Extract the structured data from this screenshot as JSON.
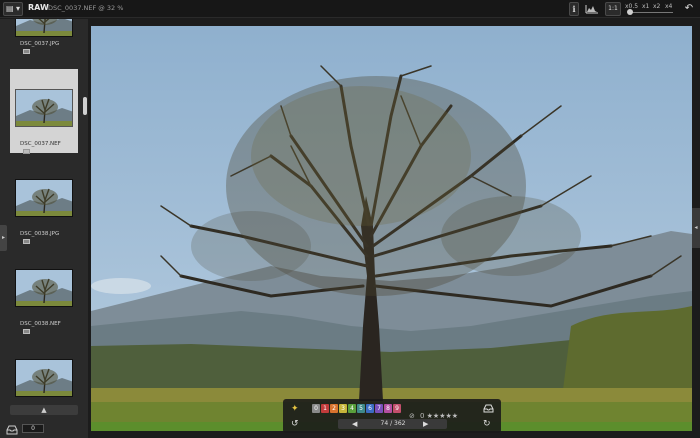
{
  "topbar": {
    "menu_glyph": "▤ ▾",
    "raw_label": "RAW",
    "file_title": "DSC_0037.NEF @ 32 %",
    "info_glyph": "i",
    "zoom_mode_label": "1:1",
    "zoom_labels": [
      "x0.5",
      "x1",
      "x2",
      "x4"
    ],
    "undo_glyph": "↶"
  },
  "sidebar": {
    "thumbnails": [
      {
        "name": "DSC_0037.JPG",
        "selected": false
      },
      {
        "name": "DSC_0037.NEF",
        "selected": true
      },
      {
        "name": "DSC_0038.JPG",
        "selected": false
      },
      {
        "name": "DSC_0038.NEF",
        "selected": false
      },
      {
        "name": "",
        "selected": false
      }
    ],
    "up_glyph": "▲",
    "left_tab_glyph": "▸",
    "tray_icon": "tray-icon",
    "count_value": "0"
  },
  "viewer": {
    "right_tab_glyph": "◂"
  },
  "panel": {
    "pin_glyph": "📌",
    "labels": [
      "0",
      "1",
      "2",
      "3",
      "4",
      "5",
      "6",
      "7",
      "8",
      "9"
    ],
    "label_colors": [
      "#8a8a8a",
      "#c23b3b",
      "#d8732e",
      "#c7b53a",
      "#5aa03c",
      "#3f8a8a",
      "#3b6cc2",
      "#7a4fb8",
      "#b34fa0",
      "#c24f6c"
    ],
    "rating_prefix": "⊘",
    "rating_stars": "0 ★★★★★",
    "rotate_left_glyph": "↺",
    "rotate_right_glyph": "↻",
    "prev_glyph": "◀",
    "next_glyph": "▶",
    "position": "74 / 362"
  }
}
